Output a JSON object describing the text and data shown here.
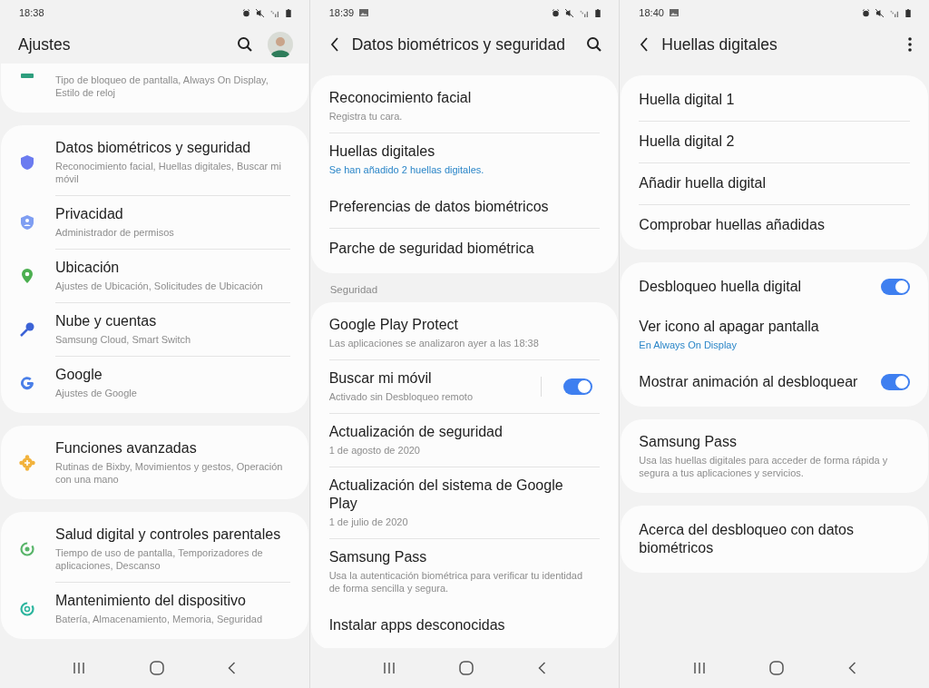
{
  "screens": [
    {
      "status": {
        "time": "18:38",
        "picture_notification": false
      },
      "header": {
        "back": false,
        "title": "Ajustes",
        "search": true,
        "avatar": true,
        "more": false
      },
      "groups": [
        {
          "clipped_top": true,
          "items": [
            {
              "subtitle": "Tipo de bloqueo de pantalla, Always On Display, Estilo de reloj",
              "accent": false
            }
          ]
        },
        {
          "clipped_top": false,
          "items": [
            {
              "title": "Datos biométricos y seguridad",
              "subtitle": "Reconocimiento facial, Huellas digitales, Buscar mi móvil",
              "accent": false
            },
            {
              "title": "Privacidad",
              "subtitle": "Administrador de permisos",
              "accent": false
            },
            {
              "title": "Ubicación",
              "subtitle": "Ajustes de Ubicación, Solicitudes de Ubicación",
              "accent": false
            },
            {
              "title": "Nube y cuentas",
              "subtitle": "Samsung Cloud, Smart Switch",
              "accent": false
            },
            {
              "title": "Google",
              "subtitle": "Ajustes de Google",
              "accent": false
            }
          ]
        },
        {
          "clipped_top": false,
          "items": [
            {
              "title": "Funciones avanzadas",
              "subtitle": "Rutinas de Bixby, Movimientos y gestos, Operación con una mano",
              "accent": false
            }
          ]
        },
        {
          "clipped_top": false,
          "items": [
            {
              "title": "Salud digital y controles parentales",
              "subtitle": "Tiempo de uso de pantalla, Temporizadores de aplicaciones, Descanso",
              "accent": false
            },
            {
              "title": "Mantenimiento del dispositivo",
              "subtitle": "Batería, Almacenamiento, Memoria, Seguridad",
              "accent": false
            }
          ]
        }
      ]
    },
    {
      "status": {
        "time": "18:39",
        "picture_notification": true
      },
      "header": {
        "back": true,
        "title": "Datos biométricos y seguridad",
        "search": true,
        "avatar": false,
        "more": false
      },
      "groups": [
        {
          "clipped_top": false,
          "items": [
            {
              "title": "Reconocimiento facial",
              "subtitle": "Registra tu cara.",
              "accent": false
            },
            {
              "title": "Huellas digitales",
              "subtitle": "Se han añadido 2 huellas digitales.",
              "accent": true
            },
            {
              "title": "Preferencias de datos biométricos"
            },
            {
              "title": "Parche de seguridad biométrica"
            }
          ]
        },
        {
          "section": "Seguridad",
          "clipped_top": false,
          "items": [
            {
              "title": "Google Play Protect",
              "subtitle": "Las aplicaciones se analizaron ayer a las 18:38",
              "accent": false
            },
            {
              "title": "Buscar mi móvil",
              "subtitle": "Activado sin Desbloqueo remoto",
              "accent": false,
              "split": true,
              "switch_on": true
            },
            {
              "title": "Actualización de seguridad",
              "subtitle": "1 de agosto de 2020",
              "accent": false
            },
            {
              "title": "Actualización del sistema de Google Play",
              "subtitle": "1 de julio de 2020",
              "accent": false
            },
            {
              "title": "Samsung Pass",
              "subtitle": "Usa la autenticación biométrica para verificar tu identidad de forma sencilla y segura.",
              "accent": false
            },
            {
              "title": "Instalar apps desconocidas"
            }
          ]
        }
      ]
    },
    {
      "status": {
        "time": "18:40",
        "picture_notification": true
      },
      "header": {
        "back": true,
        "title": "Huellas digitales",
        "search": false,
        "avatar": false,
        "more": true
      },
      "groups": [
        {
          "clipped_top": false,
          "items": [
            {
              "title": "Huella digital 1"
            },
            {
              "title": "Huella digital 2"
            },
            {
              "title": "Añadir huella digital"
            },
            {
              "title": "Comprobar huellas añadidas"
            }
          ]
        },
        {
          "clipped_top": false,
          "items": [
            {
              "title": "Desbloqueo huella digital",
              "switch_on": true
            },
            {
              "title": "Ver icono al apagar pantalla",
              "subtitle": "En Always On Display",
              "accent": true
            },
            {
              "title": "Mostrar animación al desbloquear",
              "switch_on": true
            }
          ]
        },
        {
          "clipped_top": false,
          "items": [
            {
              "title": "Samsung Pass",
              "subtitle": "Usa las huellas digitales para acceder de forma rápida y segura a tus aplicaciones y servicios.",
              "accent": false
            }
          ]
        },
        {
          "clipped_top": false,
          "items": [
            {
              "title": "Acerca del desbloqueo con datos biométricos"
            }
          ]
        }
      ]
    }
  ]
}
